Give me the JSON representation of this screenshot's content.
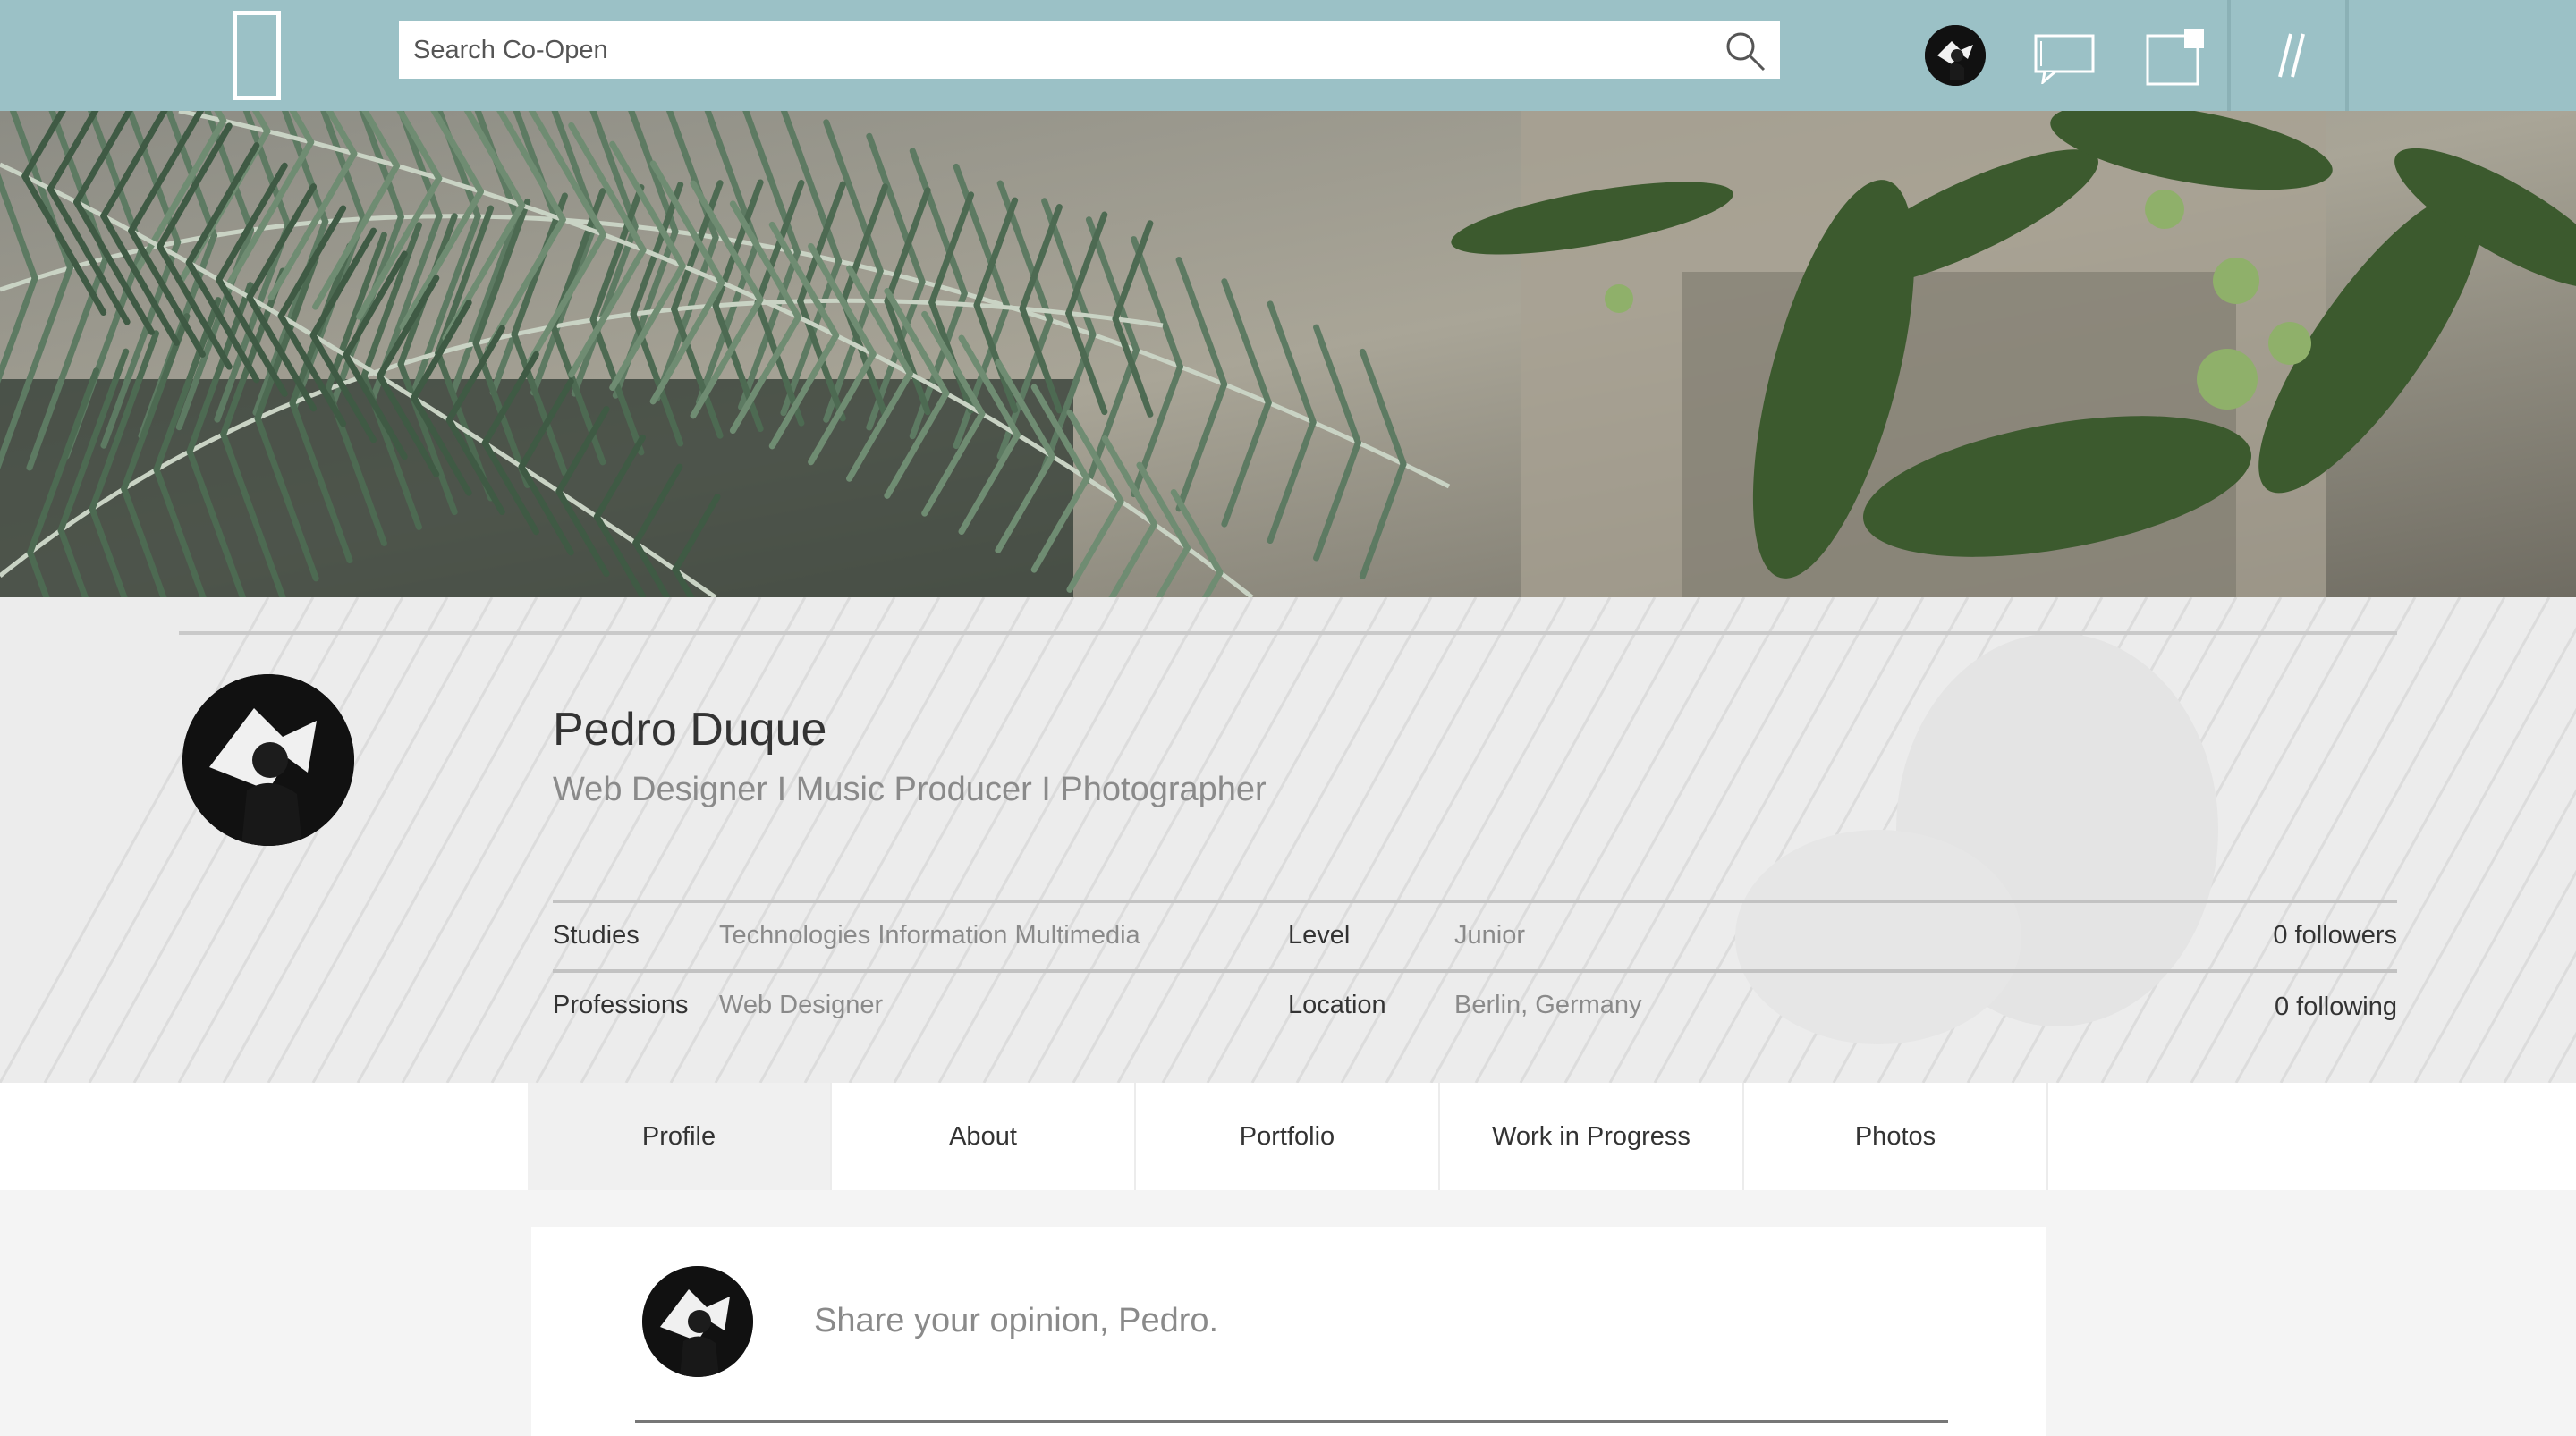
{
  "topbar": {
    "search_placeholder": "Search Co-Open",
    "menu_icon": "double-slash-menu-icon",
    "colors": {
      "bar": "#9bc1c6",
      "accent": "#ffffff"
    }
  },
  "profile": {
    "name": "Pedro Duque",
    "tagline": "Web Designer I Music Producer I Photographer",
    "studies_label": "Studies",
    "studies_value": "Technologies Information Multimedia",
    "level_label": "Level",
    "level_value": "Junior",
    "followers": "0 followers",
    "professions_label": "Professions",
    "professions_value": "Web Designer",
    "location_label": "Location",
    "location_value": "Berlin, Germany",
    "following": "0 following"
  },
  "tabs": [
    {
      "label": "Profile",
      "active": true
    },
    {
      "label": "About"
    },
    {
      "label": "Portfolio"
    },
    {
      "label": "Work in Progress"
    },
    {
      "label": "Photos"
    }
  ],
  "composer": {
    "placeholder": "Share your opinion, Pedro."
  }
}
